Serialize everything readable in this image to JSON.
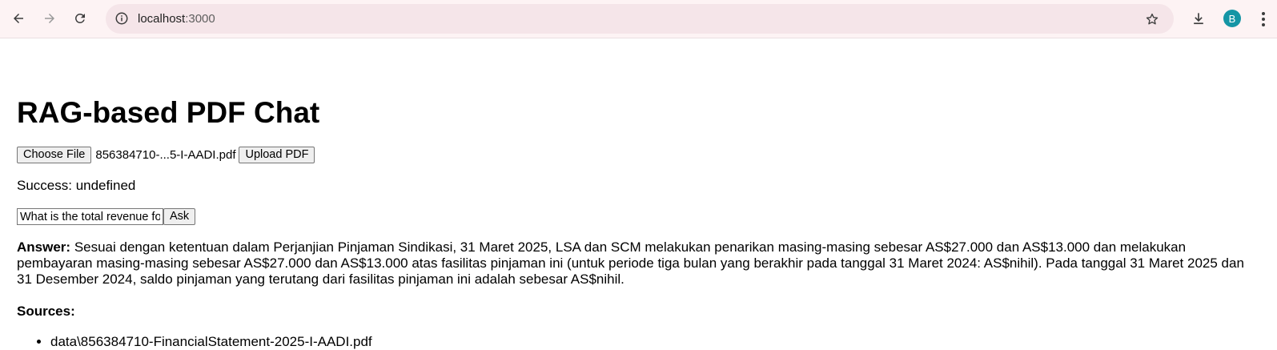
{
  "browser": {
    "url_host": "localhost",
    "url_port": ":3000",
    "avatar_letter": "B",
    "accent_color": "#1595a5"
  },
  "page": {
    "title": "RAG-based PDF Chat",
    "upload": {
      "choose_label": "Choose File",
      "file_name": "856384710-...5-I-AADI.pdf",
      "upload_label": "Upload PDF"
    },
    "status": "Success: undefined",
    "question": {
      "value": "What is the total revenue fo",
      "ask_label": "Ask"
    },
    "answer": {
      "label": "Answer:",
      "text": "Sesuai dengan ketentuan dalam Perjanjian Pinjaman Sindikasi, 31 Maret 2025, LSA dan SCM melakukan penarikan masing-masing sebesar AS$27.000 dan AS$13.000 dan melakukan pembayaran masing-masing sebesar AS$27.000 dan AS$13.000 atas fasilitas pinjaman ini (untuk periode tiga bulan yang berakhir pada tanggal 31 Maret 2024: AS$nihil). Pada tanggal 31 Maret 2025 dan 31 Desember 2024, saldo pinjaman yang terutang dari fasilitas pinjaman ini adalah sebesar AS$nihil."
    },
    "sources": {
      "heading": "Sources:",
      "items": [
        "data\\856384710-FinancialStatement-2025-I-AADI.pdf"
      ]
    }
  }
}
